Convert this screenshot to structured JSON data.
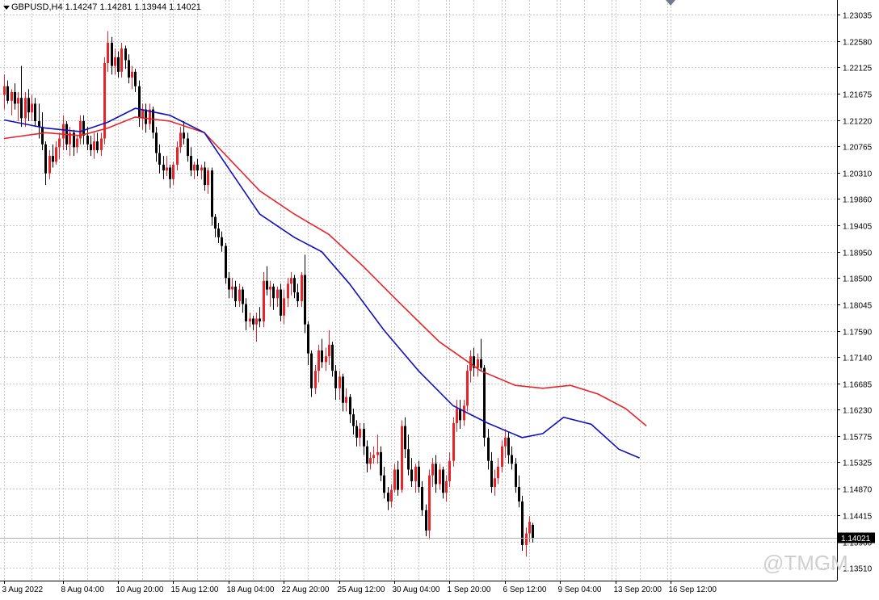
{
  "header": {
    "symbol": "GBPUSD,H4",
    "open": "1.14247",
    "high": "1.14281",
    "low": "1.13944",
    "close": "1.14021"
  },
  "watermark": "@TMGM",
  "colors": {
    "background": "#ffffff",
    "grid": "#c8c8c8",
    "bull": "#e8232a",
    "bear": "#000000",
    "ma_fast": "#1010c0",
    "ma_slow": "#e8232a",
    "axis": "#000000"
  },
  "chart_data": {
    "type": "candlestick",
    "title": "",
    "symbol": "GBPUSD",
    "timeframe": "H4",
    "ylim": [
      1.1305,
      1.2325
    ],
    "grid": true,
    "y_ticks": [
      "1.23035",
      "1.22580",
      "1.22125",
      "1.21675",
      "1.21220",
      "1.20765",
      "1.20310",
      "1.19860",
      "1.19405",
      "1.18950",
      "1.18500",
      "1.18045",
      "1.17590",
      "1.17140",
      "1.16685",
      "1.16230",
      "1.15775",
      "1.15325",
      "1.14870",
      "1.14415",
      "1.13960",
      "1.13510"
    ],
    "x_ticks": [
      {
        "label": "3 Aug 2022",
        "index": 0
      },
      {
        "label": "8 Aug 04:00",
        "index": 17
      },
      {
        "label": "10 Aug 20:00",
        "index": 33
      },
      {
        "label": "15 Aug 12:00",
        "index": 49
      },
      {
        "label": "18 Aug 04:00",
        "index": 65
      },
      {
        "label": "22 Aug 20:00",
        "index": 81
      },
      {
        "label": "25 Aug 12:00",
        "index": 97
      },
      {
        "label": "30 Aug 04:00",
        "index": 113
      },
      {
        "label": "1 Sep 20:00",
        "index": 129
      },
      {
        "label": "6 Sep 12:00",
        "index": 145
      },
      {
        "label": "9 Sep 04:00",
        "index": 161
      },
      {
        "label": "13 Sep 20:00",
        "index": 177
      },
      {
        "label": "16 Sep 12:00",
        "index": 193
      }
    ],
    "current_price": "1.14021",
    "current_price_value": 1.14021,
    "candles": [
      [
        1.2165,
        1.22,
        1.214,
        1.218
      ],
      [
        1.218,
        1.219,
        1.215,
        1.2155
      ],
      [
        1.2155,
        1.2175,
        1.213,
        1.217
      ],
      [
        1.217,
        1.2185,
        1.214,
        1.215
      ],
      [
        1.215,
        1.217,
        1.212,
        1.216
      ],
      [
        1.216,
        1.2215,
        1.211,
        1.2125
      ],
      [
        1.2125,
        1.217,
        1.211,
        1.216
      ],
      [
        1.216,
        1.2175,
        1.212,
        1.2135
      ],
      [
        1.2135,
        1.2165,
        1.212,
        1.215
      ],
      [
        1.215,
        1.216,
        1.211,
        1.212
      ],
      [
        1.212,
        1.215,
        1.209,
        1.211
      ],
      [
        1.211,
        1.2135,
        1.207,
        1.208
      ],
      [
        1.208,
        1.2085,
        1.201,
        1.203
      ],
      [
        1.203,
        1.207,
        1.202,
        1.206
      ],
      [
        1.206,
        1.208,
        1.204,
        1.205
      ],
      [
        1.205,
        1.2085,
        1.2045,
        1.2075
      ],
      [
        1.2075,
        1.21,
        1.2055,
        1.209
      ],
      [
        1.209,
        1.213,
        1.207,
        1.2115
      ],
      [
        1.2115,
        1.212,
        1.207,
        1.208
      ],
      [
        1.208,
        1.211,
        1.206,
        1.21
      ],
      [
        1.21,
        1.2105,
        1.206,
        1.2075
      ],
      [
        1.2075,
        1.2095,
        1.2065,
        1.209
      ],
      [
        1.209,
        1.213,
        1.208,
        1.212
      ],
      [
        1.212,
        1.213,
        1.208,
        1.2095
      ],
      [
        1.2095,
        1.211,
        1.207,
        1.208
      ],
      [
        1.208,
        1.2095,
        1.206,
        1.207
      ],
      [
        1.207,
        1.21,
        1.2055,
        1.2085
      ],
      [
        1.2085,
        1.21,
        1.2065,
        1.207
      ],
      [
        1.207,
        1.21,
        1.206,
        1.209
      ],
      [
        1.209,
        1.223,
        1.208,
        1.222
      ],
      [
        1.222,
        1.2275,
        1.2205,
        1.2255
      ],
      [
        1.2255,
        1.2265,
        1.22,
        1.2215
      ],
      [
        1.2215,
        1.2245,
        1.22,
        1.223
      ],
      [
        1.223,
        1.224,
        1.2195,
        1.2205
      ],
      [
        1.2205,
        1.2255,
        1.2195,
        1.2245
      ],
      [
        1.2245,
        1.225,
        1.221,
        1.2225
      ],
      [
        1.2225,
        1.2235,
        1.2185,
        1.2195
      ],
      [
        1.2195,
        1.2215,
        1.2175,
        1.2205
      ],
      [
        1.2205,
        1.221,
        1.217,
        1.218
      ],
      [
        1.218,
        1.219,
        1.211,
        1.2125
      ],
      [
        1.2125,
        1.215,
        1.2105,
        1.214
      ],
      [
        1.214,
        1.215,
        1.21,
        1.2115
      ],
      [
        1.2115,
        1.215,
        1.2105,
        1.214
      ],
      [
        1.214,
        1.2145,
        1.209,
        1.21
      ],
      [
        1.21,
        1.211,
        1.205,
        1.2065
      ],
      [
        1.2065,
        1.208,
        1.203,
        1.2045
      ],
      [
        1.2045,
        1.206,
        1.202,
        1.2035
      ],
      [
        1.2035,
        1.206,
        1.2025,
        1.204
      ],
      [
        1.204,
        1.2045,
        1.2005,
        1.202
      ],
      [
        1.202,
        1.205,
        1.201,
        1.2045
      ],
      [
        1.2045,
        1.2085,
        1.2035,
        1.2075
      ],
      [
        1.2075,
        1.211,
        1.2065,
        1.21
      ],
      [
        1.21,
        1.212,
        1.208,
        1.209
      ],
      [
        1.209,
        1.21,
        1.205,
        1.206
      ],
      [
        1.206,
        1.2075,
        1.2025,
        1.2035
      ],
      [
        1.2035,
        1.205,
        1.202,
        1.2045
      ],
      [
        1.2045,
        1.2055,
        1.2025,
        1.2035
      ],
      [
        1.2035,
        1.2045,
        1.202,
        1.204
      ],
      [
        1.204,
        1.205,
        1.2,
        1.201
      ],
      [
        1.201,
        1.204,
        1.1995,
        1.2035
      ],
      [
        1.2035,
        1.204,
        1.194,
        1.1955
      ],
      [
        1.1955,
        1.196,
        1.192,
        1.1935
      ],
      [
        1.1935,
        1.1945,
        1.191,
        1.192
      ],
      [
        1.192,
        1.193,
        1.1895,
        1.1905
      ],
      [
        1.1905,
        1.191,
        1.184,
        1.185
      ],
      [
        1.185,
        1.186,
        1.1815,
        1.183
      ],
      [
        1.183,
        1.185,
        1.1815,
        1.1835
      ],
      [
        1.1835,
        1.1845,
        1.18,
        1.181
      ],
      [
        1.181,
        1.184,
        1.18,
        1.183
      ],
      [
        1.183,
        1.1835,
        1.179,
        1.1805
      ],
      [
        1.1805,
        1.1815,
        1.176,
        1.1775
      ],
      [
        1.1775,
        1.179,
        1.1765,
        1.178
      ],
      [
        1.178,
        1.1785,
        1.176,
        1.177
      ],
      [
        1.177,
        1.179,
        1.174,
        1.178
      ],
      [
        1.178,
        1.18,
        1.1765,
        1.1775
      ],
      [
        1.1775,
        1.186,
        1.1765,
        1.1845
      ],
      [
        1.1845,
        1.187,
        1.182,
        1.183
      ],
      [
        1.183,
        1.1845,
        1.18,
        1.1835
      ],
      [
        1.1835,
        1.184,
        1.1795,
        1.1815
      ],
      [
        1.1815,
        1.1835,
        1.18,
        1.183
      ],
      [
        1.183,
        1.184,
        1.1775,
        1.1785
      ],
      [
        1.1785,
        1.183,
        1.177,
        1.1815
      ],
      [
        1.1815,
        1.185,
        1.18,
        1.184
      ],
      [
        1.184,
        1.186,
        1.182,
        1.185
      ],
      [
        1.185,
        1.1855,
        1.1815,
        1.1825
      ],
      [
        1.1825,
        1.184,
        1.18,
        1.181
      ],
      [
        1.181,
        1.186,
        1.18,
        1.1855
      ],
      [
        1.1855,
        1.189,
        1.1755,
        1.177
      ],
      [
        1.177,
        1.1775,
        1.17,
        1.172
      ],
      [
        1.172,
        1.1725,
        1.1645,
        1.166
      ],
      [
        1.166,
        1.17,
        1.165,
        1.169
      ],
      [
        1.169,
        1.1735,
        1.167,
        1.1725
      ],
      [
        1.1725,
        1.1745,
        1.1695,
        1.1705
      ],
      [
        1.1705,
        1.173,
        1.169,
        1.1715
      ],
      [
        1.1715,
        1.176,
        1.17,
        1.1735
      ],
      [
        1.1735,
        1.174,
        1.168,
        1.169
      ],
      [
        1.169,
        1.17,
        1.164,
        1.166
      ],
      [
        1.166,
        1.169,
        1.164,
        1.168
      ],
      [
        1.168,
        1.1685,
        1.162,
        1.1635
      ],
      [
        1.1635,
        1.166,
        1.162,
        1.1645
      ],
      [
        1.1645,
        1.165,
        1.16,
        1.1615
      ],
      [
        1.1615,
        1.1625,
        1.158,
        1.1595
      ],
      [
        1.1595,
        1.1605,
        1.156,
        1.1575
      ],
      [
        1.1575,
        1.16,
        1.156,
        1.159
      ],
      [
        1.159,
        1.16,
        1.1545,
        1.156
      ],
      [
        1.156,
        1.157,
        1.1515,
        1.153
      ],
      [
        1.153,
        1.155,
        1.152,
        1.154
      ],
      [
        1.154,
        1.156,
        1.153,
        1.1545
      ],
      [
        1.1545,
        1.158,
        1.153,
        1.155
      ],
      [
        1.155,
        1.156,
        1.15,
        1.151
      ],
      [
        1.151,
        1.1525,
        1.147,
        1.148
      ],
      [
        1.148,
        1.149,
        1.145,
        1.1465
      ],
      [
        1.1465,
        1.1495,
        1.1455,
        1.1485
      ],
      [
        1.1485,
        1.153,
        1.148,
        1.152
      ],
      [
        1.152,
        1.1535,
        1.1475,
        1.1485
      ],
      [
        1.1485,
        1.1605,
        1.148,
        1.1595
      ],
      [
        1.1595,
        1.161,
        1.154,
        1.1555
      ],
      [
        1.1555,
        1.158,
        1.151,
        1.152
      ],
      [
        1.152,
        1.154,
        1.149,
        1.15
      ],
      [
        1.15,
        1.153,
        1.148,
        1.1525
      ],
      [
        1.1525,
        1.1535,
        1.148,
        1.149
      ],
      [
        1.149,
        1.15,
        1.144,
        1.145
      ],
      [
        1.145,
        1.146,
        1.1405,
        1.1415
      ],
      [
        1.1415,
        1.152,
        1.14,
        1.151
      ],
      [
        1.151,
        1.154,
        1.149,
        1.153
      ],
      [
        1.153,
        1.1545,
        1.148,
        1.1495
      ],
      [
        1.1495,
        1.153,
        1.1485,
        1.152
      ],
      [
        1.152,
        1.1525,
        1.147,
        1.148
      ],
      [
        1.148,
        1.151,
        1.1465,
        1.15
      ],
      [
        1.15,
        1.155,
        1.149,
        1.1535
      ],
      [
        1.1535,
        1.161,
        1.1525,
        1.16
      ],
      [
        1.16,
        1.164,
        1.1585,
        1.1625
      ],
      [
        1.1625,
        1.164,
        1.159,
        1.1605
      ],
      [
        1.1605,
        1.164,
        1.1595,
        1.163
      ],
      [
        1.163,
        1.17,
        1.162,
        1.169
      ],
      [
        1.169,
        1.1725,
        1.167,
        1.1715
      ],
      [
        1.1715,
        1.173,
        1.168,
        1.1695
      ],
      [
        1.1695,
        1.172,
        1.168,
        1.171
      ],
      [
        1.171,
        1.1745,
        1.169,
        1.1695
      ],
      [
        1.1695,
        1.17,
        1.156,
        1.1575
      ],
      [
        1.1575,
        1.159,
        1.152,
        1.1535
      ],
      [
        1.1535,
        1.155,
        1.148,
        1.149
      ],
      [
        1.149,
        1.152,
        1.1475,
        1.1505
      ],
      [
        1.1505,
        1.154,
        1.1495,
        1.1525
      ],
      [
        1.1525,
        1.157,
        1.1515,
        1.156
      ],
      [
        1.156,
        1.159,
        1.154,
        1.1575
      ],
      [
        1.1575,
        1.1585,
        1.153,
        1.1545
      ],
      [
        1.1545,
        1.156,
        1.152,
        1.153
      ],
      [
        1.153,
        1.154,
        1.148,
        1.149
      ],
      [
        1.149,
        1.151,
        1.1455,
        1.1465
      ],
      [
        1.1465,
        1.1475,
        1.138,
        1.139
      ],
      [
        1.139,
        1.142,
        1.137,
        1.141
      ],
      [
        1.141,
        1.144,
        1.1395,
        1.143
      ],
      [
        1.14247,
        1.14281,
        1.13944,
        1.14021
      ]
    ],
    "ma_fast": [
      [
        0,
        1.2122
      ],
      [
        12,
        1.2108
      ],
      [
        22,
        1.2102
      ],
      [
        30,
        1.2118
      ],
      [
        38,
        1.2142
      ],
      [
        48,
        1.213
      ],
      [
        58,
        1.21
      ],
      [
        66,
        1.203
      ],
      [
        74,
        1.196
      ],
      [
        84,
        1.192
      ],
      [
        92,
        1.1895
      ],
      [
        100,
        1.184
      ],
      [
        110,
        1.176
      ],
      [
        120,
        1.169
      ],
      [
        130,
        1.163
      ],
      [
        140,
        1.16
      ],
      [
        150,
        1.1575
      ],
      [
        156,
        1.1582
      ],
      [
        162,
        1.161
      ],
      [
        170,
        1.1598
      ],
      [
        178,
        1.1555
      ],
      [
        184,
        1.154
      ]
    ],
    "ma_slow": [
      [
        0,
        1.209
      ],
      [
        12,
        1.21
      ],
      [
        22,
        1.2095
      ],
      [
        30,
        1.2108
      ],
      [
        38,
        1.2127
      ],
      [
        48,
        1.212
      ],
      [
        58,
        1.21
      ],
      [
        66,
        1.205
      ],
      [
        74,
        1.2
      ],
      [
        84,
        1.196
      ],
      [
        94,
        1.1925
      ],
      [
        104,
        1.187
      ],
      [
        114,
        1.181
      ],
      [
        126,
        1.174
      ],
      [
        138,
        1.169
      ],
      [
        148,
        1.1665
      ],
      [
        156,
        1.166
      ],
      [
        164,
        1.1665
      ],
      [
        172,
        1.165
      ],
      [
        180,
        1.1625
      ],
      [
        186,
        1.1595
      ]
    ]
  }
}
